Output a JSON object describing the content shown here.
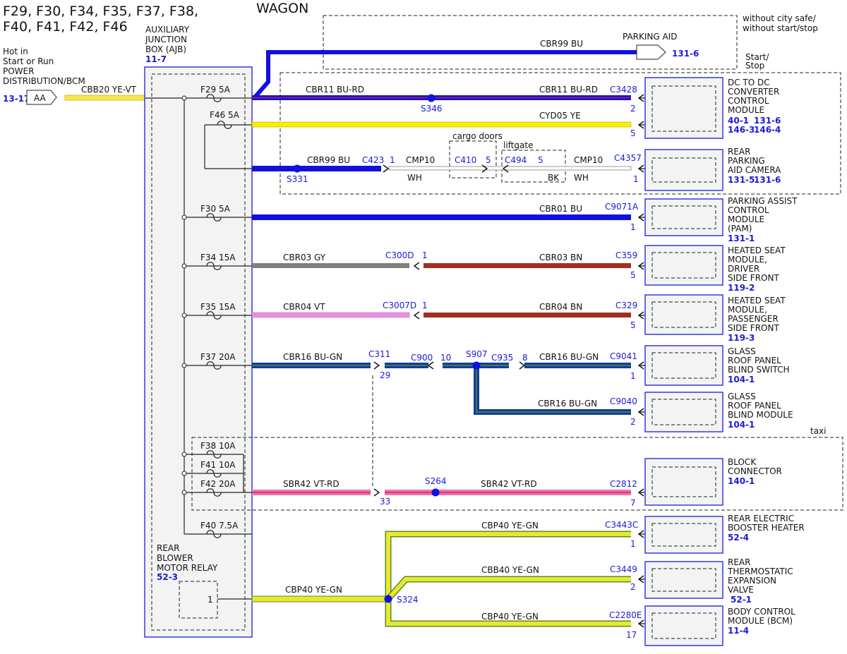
{
  "titles": {
    "fuse_line1": "F29, F30, F34, F35, F37, F38,",
    "fuse_line2": "F40, F41, F42, F46",
    "variant": "WAGON"
  },
  "source": {
    "line1": "Hot in",
    "line2": "Start or Run",
    "line3": "POWER",
    "line4": "DISTRIBUTION/BCM",
    "ref": "13-17",
    "connector": "AA",
    "circuit": "CBB20  YE-VT"
  },
  "ajb": {
    "line1": "AUXILIARY",
    "line2": "JUNCTION",
    "line3": "BOX (AJB)",
    "ref": "11-7",
    "relay_line1": "REAR",
    "relay_line2": "BLOWER",
    "relay_line3": "MOTOR RELAY",
    "relay_ref": "52-3",
    "relay_pin": "1"
  },
  "fuses": {
    "f29": "F29 5A",
    "f46": "F46 5A",
    "f30": "F30 5A",
    "f34": "F34 15A",
    "f35": "F35 15A",
    "f37": "F37 20A",
    "f38": "F38 10A",
    "f41": "F41 10A",
    "f42": "F42 20A",
    "f40": "F40 7.5A"
  },
  "notes": {
    "without": "without city safe/",
    "without2": "without start/stop",
    "startstop": "Start/",
    "startstop2": "Stop",
    "cargo": "cargo doors",
    "liftgate": "liftgate",
    "taxi": "taxi"
  },
  "circuits": {
    "cbr99_top": "CBR99  BU",
    "parking_aid": "PARKING AID",
    "parking_aid_ref": "131-6",
    "cbr11_a": "CBR11  BU-RD",
    "cbr11_b": "CBR11  BU-RD",
    "cyd05": "CYD05  YE",
    "cbr99": "CBR99  BU",
    "cmp10_a": "CMP10",
    "wh_a": "WH",
    "bk": "BK",
    "cmp10_b": "CMP10",
    "wh_b": "WH",
    "cbr01": "CBR01  BU",
    "cbr03_a": "CBR03  GY",
    "cbr03_b": "CBR03  BN",
    "cbr04_a": "CBR04  VT",
    "cbr04_b": "CBR04  BN",
    "cbr16_a": "CBR16  BU-GN",
    "cbr16_b": "CBR16  BU-GN",
    "cbr16_c": "CBR16  BU-GN",
    "sbr42_a": "SBR42  VT-RD",
    "sbr42_b": "SBR42  VT-RD",
    "cbp40_a": "CBP40  YE-GN",
    "cbb40": "CBB40  YE-GN",
    "cbp40_c": "CBP40  YE-GN",
    "cbp40_src": "CBP40  YE-GN"
  },
  "connectors": {
    "c3428": "C3428",
    "c3428_p": "2",
    "c3428_p2": "5",
    "c423": "C423",
    "c423_p": "1",
    "c410": "C410",
    "c410_p": "5",
    "c494": "C494",
    "c494_p": "5",
    "c4357": "C4357",
    "c4357_p": "1",
    "c9071a": "C9071A",
    "c9071a_p": "1",
    "c300d": "C300D",
    "c300d_p": "1",
    "c359": "C359",
    "c359_p": "5",
    "c3007d": "C3007D",
    "c3007d_p": "1",
    "c329": "C329",
    "c329_p": "5",
    "c311": "C311",
    "c311_p": "29",
    "c311_p2": "33",
    "c900": "C900",
    "c900_p": "10",
    "c935": "C935",
    "c935_p": "8",
    "c9041": "C9041",
    "c9041_p": "1",
    "c9040": "C9040",
    "c9040_p": "2",
    "c2812": "C2812",
    "c2812_p": "7",
    "c3443c": "C3443C",
    "c3443c_p": "1",
    "c3449": "C3449",
    "c3449_p": "2",
    "c2280e": "C2280E",
    "c2280e_p": "17"
  },
  "splices": {
    "s346": "S346",
    "s331": "S331",
    "s907": "S907",
    "s264": "S264",
    "s324": "S324"
  },
  "modules": {
    "dcdc": {
      "l1": "DC TO DC",
      "l2": "CONVERTER",
      "l3": "CONTROL",
      "l4": "MODULE",
      "r1a": "40-1",
      "r1b": "131-6",
      "r2a": "146-3",
      "r2b": "146-4"
    },
    "camera": {
      "l1": "REAR",
      "l2": "PARKING",
      "l3": "AID CAMERA",
      "r1a": "131-5",
      "r1b": "131-6"
    },
    "pam": {
      "l1": "PARKING ASSIST",
      "l2": "CONTROL",
      "l3": "MODULE",
      "l4": "(PAM)",
      "ref": "131-1"
    },
    "hsd": {
      "l1": "HEATED SEAT",
      "l2": "MODULE,",
      "l3": "DRIVER",
      "l4": "SIDE FRONT",
      "ref": "119-2"
    },
    "hsp": {
      "l1": "HEATED SEAT",
      "l2": "MODULE,",
      "l3": "PASSENGER",
      "l4": "SIDE FRONT",
      "ref": "119-3"
    },
    "grs": {
      "l1": "GLASS",
      "l2": "ROOF PANEL",
      "l3": "BLIND SWITCH",
      "ref": "104-1"
    },
    "grm": {
      "l1": "GLASS",
      "l2": "ROOF PANEL",
      "l3": "BLIND MODULE",
      "ref": "104-1"
    },
    "block": {
      "l1": "BLOCK",
      "l2": "CONNECTOR",
      "ref": "140-1"
    },
    "rebh": {
      "l1": "REAR ELECTRIC",
      "l2": "BOOSTER HEATER",
      "ref": "52-4"
    },
    "rtev": {
      "l1": "REAR",
      "l2": "THERMOSTATIC",
      "l3": "EXPANSION",
      "l4": "VALVE",
      "ref": "52-1"
    },
    "bcm": {
      "l1": "BODY CONTROL",
      "l2": "MODULE (BCM)",
      "ref": "11-4"
    }
  }
}
